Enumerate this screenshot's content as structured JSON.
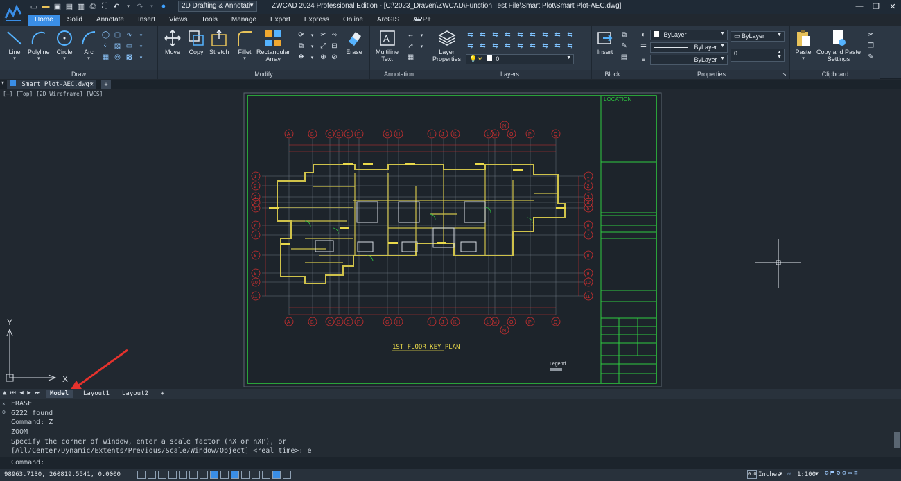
{
  "titlebar": {
    "workspace": "2D Drafting & Annotati",
    "title": "ZWCAD 2024 Professional Edition - [C:\\2023_Draven\\ZWCAD\\Function Test File\\Smart Plot\\Smart Plot-AEC.dwg]"
  },
  "tabs": [
    "Home",
    "Solid",
    "Annotate",
    "Insert",
    "Views",
    "Tools",
    "Manage",
    "Export",
    "Express",
    "Online",
    "ArcGIS",
    "APP+"
  ],
  "ribbon": {
    "draw": {
      "title": "Draw",
      "line": "Line",
      "polyline": "Polyline",
      "circle": "Circle",
      "arc": "Arc"
    },
    "modify": {
      "title": "Modify",
      "move": "Move",
      "copy": "Copy",
      "stretch": "Stretch",
      "fillet": "Fillet",
      "rect_array_1": "Rectangular",
      "rect_array_2": "Array",
      "erase": "Erase"
    },
    "annotation": {
      "title": "Annotation",
      "mtext_1": "Multiline",
      "mtext_2": "Text"
    },
    "layers": {
      "title": "Layers",
      "props_1": "Layer",
      "props_2": "Properties",
      "current_layer": "0"
    },
    "block": {
      "title": "Block",
      "insert": "Insert"
    },
    "properties": {
      "title": "Properties",
      "color": "ByLayer",
      "linetype": "ByLayer",
      "lineweight": "ByLayer",
      "plotstyle": "ByLayer",
      "transparency": "0"
    },
    "clipboard": {
      "title": "Clipboard",
      "paste": "Paste",
      "copy_paste_1": "Copy and Paste",
      "copy_paste_2": "Settings"
    }
  },
  "doc_tab": "Smart Plot-AEC.dwg*",
  "viewport_label": "[—] [Top] [2D Wireframe] [WCS]",
  "drawing": {
    "title": "1ST FLOOR KEY PLAN",
    "location_label": "LOCATION",
    "legend_label": "Legend",
    "axis_letters_top": [
      "A",
      "B",
      "C",
      "D",
      "E",
      "F",
      "G",
      "H",
      "I",
      "J",
      "K",
      "L",
      "M",
      "N",
      "O",
      "P",
      "Q"
    ],
    "axis_numbers": [
      "1",
      "2",
      "3",
      "4",
      "5",
      "6",
      "7",
      "8",
      "9",
      "10",
      "11"
    ]
  },
  "layout_tabs": [
    "Model",
    "Layout1",
    "Layout2"
  ],
  "command_history": [
    "ERASE",
    "6222 found",
    "Command: Z",
    "ZOOM",
    "Specify the corner of window, enter a scale factor (nX or nXP), or",
    "[All/Center/Dynamic/Extents/Previous/Scale/Window/Object] <real time>: e"
  ],
  "command_prompt": "Command:",
  "status": {
    "coordinates": "98963.7130, 260819.5541, 0.0000",
    "units": "Inches",
    "scale": "1:100"
  },
  "colors": {
    "accent": "#3a8ee6",
    "titleblock": "#2ecc40",
    "gridline": "#d23030",
    "walls": "#cfc24a"
  }
}
